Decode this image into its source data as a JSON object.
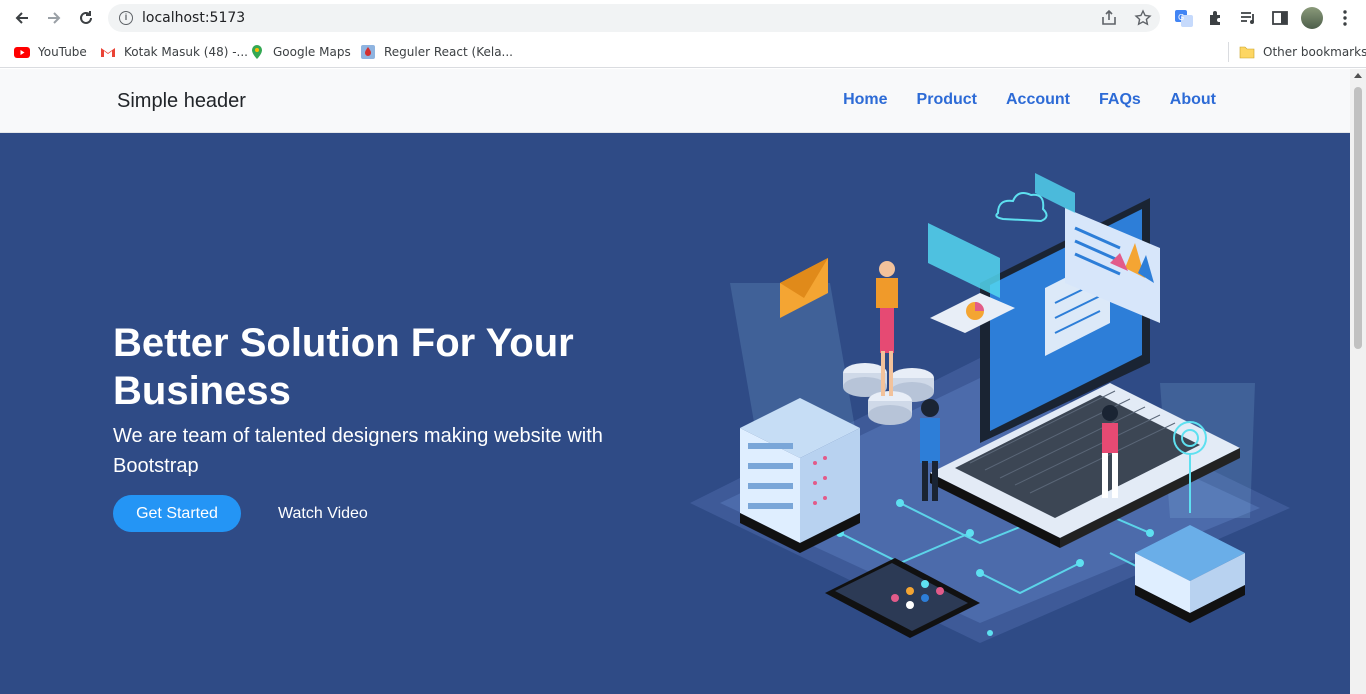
{
  "browser": {
    "url": "localhost:5173",
    "bookmarks": [
      {
        "label": "YouTube",
        "icon": "youtube-icon"
      },
      {
        "label": "Kotak Masuk (48) -...",
        "icon": "gmail-icon"
      },
      {
        "label": "Google Maps",
        "icon": "maps-icon"
      },
      {
        "label": "Reguler React (Kela...",
        "icon": "react-icon"
      }
    ],
    "other_bookmarks": "Other bookmarks"
  },
  "header": {
    "brand": "Simple header",
    "nav": [
      "Home",
      "Product",
      "Account",
      "FAQs",
      "About"
    ]
  },
  "hero": {
    "title": "Better Solution For Your Business",
    "subtitle": "We are team of talented designers making website with Bootstrap",
    "primary_button": "Get Started",
    "secondary_link": "Watch Video"
  },
  "colors": {
    "hero_bg": "#2f4b86",
    "nav_link": "#2d6bd6",
    "primary_button": "#2495f5"
  }
}
